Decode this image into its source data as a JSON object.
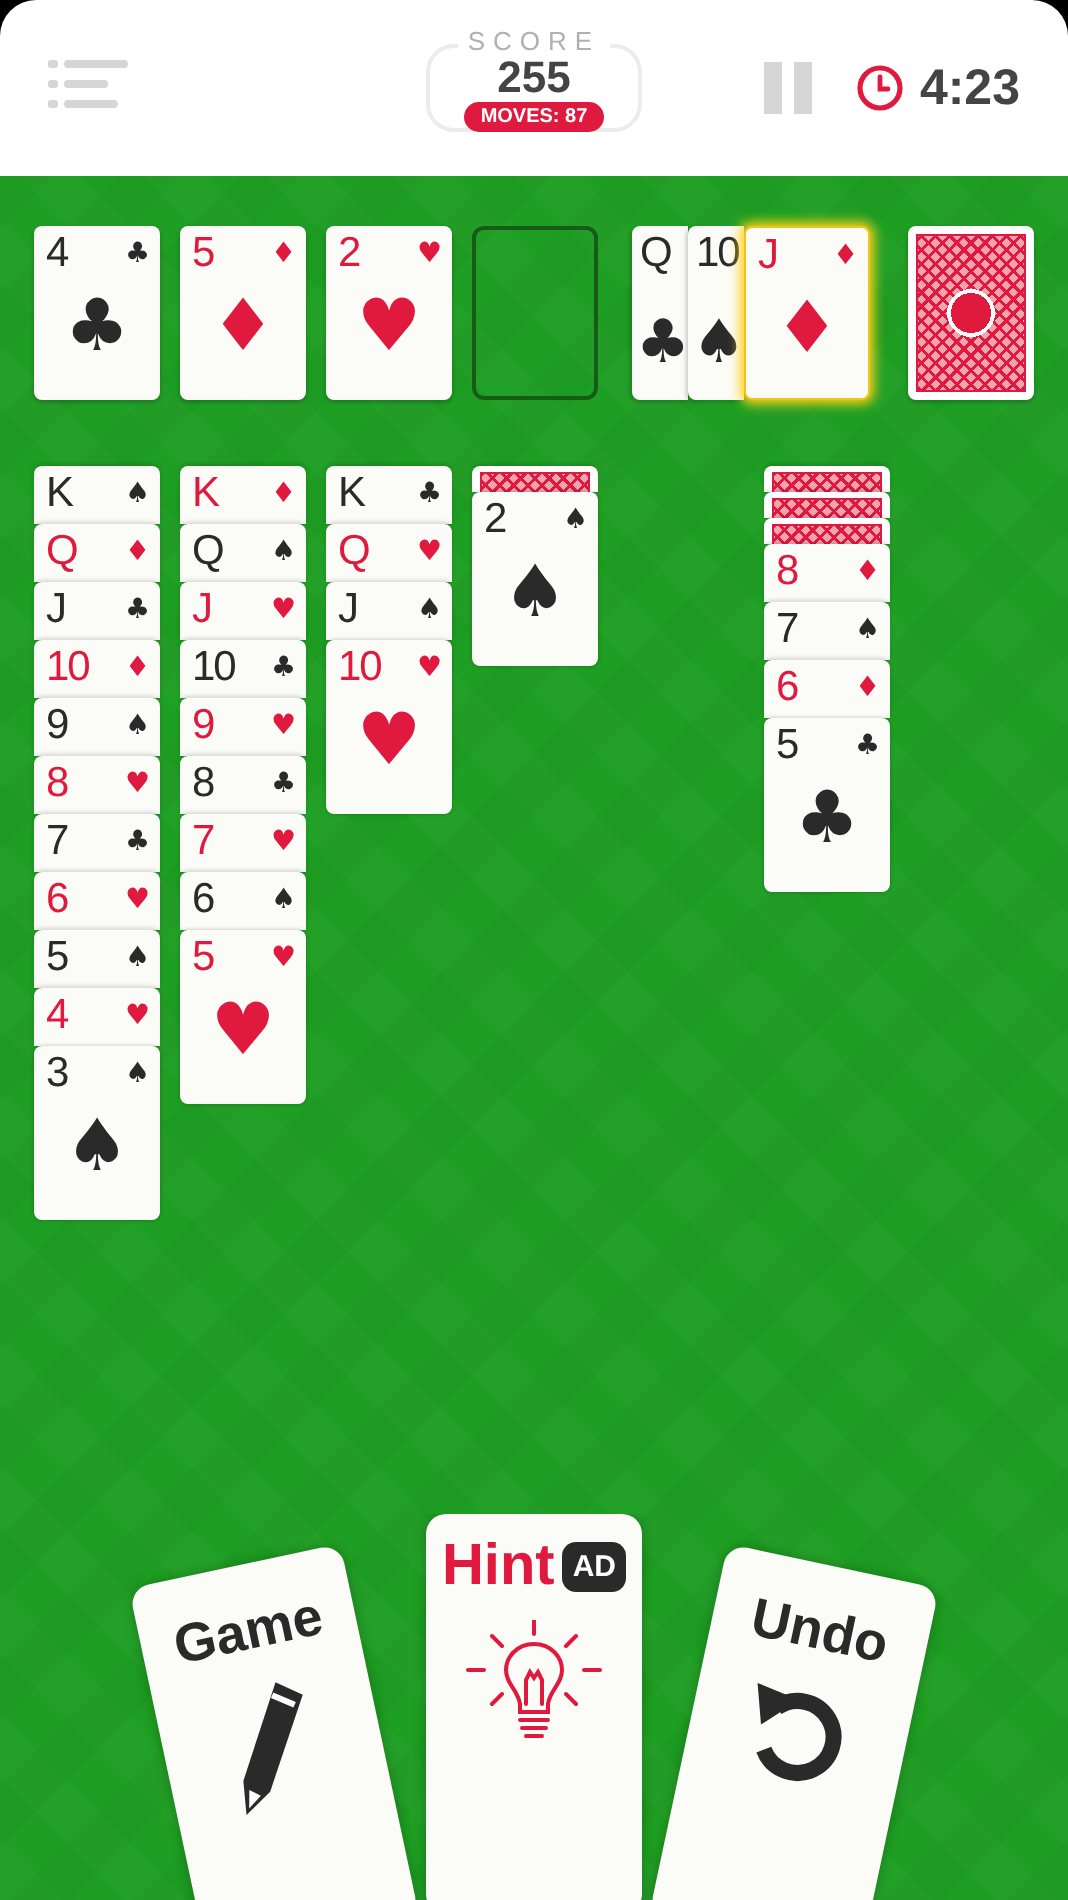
{
  "top_bar": {
    "score_label": "SCORE",
    "score": "255",
    "moves": "MOVES: 87",
    "time": "4:23"
  },
  "foundations": [
    {
      "kind": "card",
      "rank": "4",
      "suit": "♣",
      "color": "#2a2a2a"
    },
    {
      "kind": "card",
      "rank": "5",
      "suit": "♦",
      "color": "#e0193f"
    },
    {
      "kind": "card",
      "rank": "2",
      "suit": "♥",
      "color": "#e0193f"
    },
    {
      "kind": "slot"
    }
  ],
  "waste": [
    {
      "rank": "Q",
      "suit": "♣",
      "color": "#2a2a2a",
      "selected": false
    },
    {
      "rank": "10",
      "suit": "♠",
      "color": "#2a2a2a",
      "selected": false
    },
    {
      "rank": "J",
      "suit": "♦",
      "color": "#e0193f",
      "selected": true
    }
  ],
  "stock": {
    "face_up": false
  },
  "tableau": [
    {
      "kind": "pile",
      "cards": [
        {
          "face_up": true,
          "rank": "K",
          "suit": "♠",
          "color": "#2a2a2a"
        },
        {
          "face_up": true,
          "rank": "Q",
          "suit": "♦",
          "color": "#e0193f"
        },
        {
          "face_up": true,
          "rank": "J",
          "suit": "♣",
          "color": "#2a2a2a"
        },
        {
          "face_up": true,
          "rank": "10",
          "suit": "♦",
          "color": "#e0193f"
        },
        {
          "face_up": true,
          "rank": "9",
          "suit": "♠",
          "color": "#2a2a2a"
        },
        {
          "face_up": true,
          "rank": "8",
          "suit": "♥",
          "color": "#e0193f"
        },
        {
          "face_up": true,
          "rank": "7",
          "suit": "♣",
          "color": "#2a2a2a"
        },
        {
          "face_up": true,
          "rank": "6",
          "suit": "♥",
          "color": "#e0193f"
        },
        {
          "face_up": true,
          "rank": "5",
          "suit": "♠",
          "color": "#2a2a2a"
        },
        {
          "face_up": true,
          "rank": "4",
          "suit": "♥",
          "color": "#e0193f"
        },
        {
          "face_up": true,
          "rank": "3",
          "suit": "♠",
          "color": "#2a2a2a"
        }
      ]
    },
    {
      "kind": "pile",
      "cards": [
        {
          "face_up": true,
          "rank": "K",
          "suit": "♦",
          "color": "#e0193f"
        },
        {
          "face_up": true,
          "rank": "Q",
          "suit": "♠",
          "color": "#2a2a2a"
        },
        {
          "face_up": true,
          "rank": "J",
          "suit": "♥",
          "color": "#e0193f"
        },
        {
          "face_up": true,
          "rank": "10",
          "suit": "♣",
          "color": "#2a2a2a"
        },
        {
          "face_up": true,
          "rank": "9",
          "suit": "♥",
          "color": "#e0193f"
        },
        {
          "face_up": true,
          "rank": "8",
          "suit": "♣",
          "color": "#2a2a2a"
        },
        {
          "face_up": true,
          "rank": "7",
          "suit": "♥",
          "color": "#e0193f"
        },
        {
          "face_up": true,
          "rank": "6",
          "suit": "♠",
          "color": "#2a2a2a"
        },
        {
          "face_up": true,
          "rank": "5",
          "suit": "♥",
          "color": "#e0193f"
        }
      ]
    },
    {
      "kind": "pile",
      "cards": [
        {
          "face_up": true,
          "rank": "K",
          "suit": "♣",
          "color": "#2a2a2a"
        },
        {
          "face_up": true,
          "rank": "Q",
          "suit": "♥",
          "color": "#e0193f"
        },
        {
          "face_up": true,
          "rank": "J",
          "suit": "♠",
          "color": "#2a2a2a"
        },
        {
          "face_up": true,
          "rank": "10",
          "suit": "♥",
          "color": "#e0193f"
        }
      ]
    },
    {
      "kind": "pile",
      "cards": [
        {
          "face_up": false
        },
        {
          "face_up": true,
          "rank": "2",
          "suit": "♠",
          "color": "#2a2a2a"
        }
      ]
    },
    {
      "kind": "empty"
    },
    {
      "kind": "pile",
      "cards": [
        {
          "face_up": false
        },
        {
          "face_up": false
        },
        {
          "face_up": false
        },
        {
          "face_up": true,
          "rank": "8",
          "suit": "♦",
          "color": "#e0193f"
        },
        {
          "face_up": true,
          "rank": "7",
          "suit": "♠",
          "color": "#2a2a2a"
        },
        {
          "face_up": true,
          "rank": "6",
          "suit": "♦",
          "color": "#e0193f"
        },
        {
          "face_up": true,
          "rank": "5",
          "suit": "♣",
          "color": "#2a2a2a"
        }
      ]
    },
    {
      "kind": "empty"
    }
  ],
  "actions": [
    {
      "kind": "new_game",
      "label": "Game"
    },
    {
      "kind": "hint",
      "label": "Hint",
      "badge": "AD"
    },
    {
      "kind": "undo",
      "label": "Undo"
    }
  ]
}
